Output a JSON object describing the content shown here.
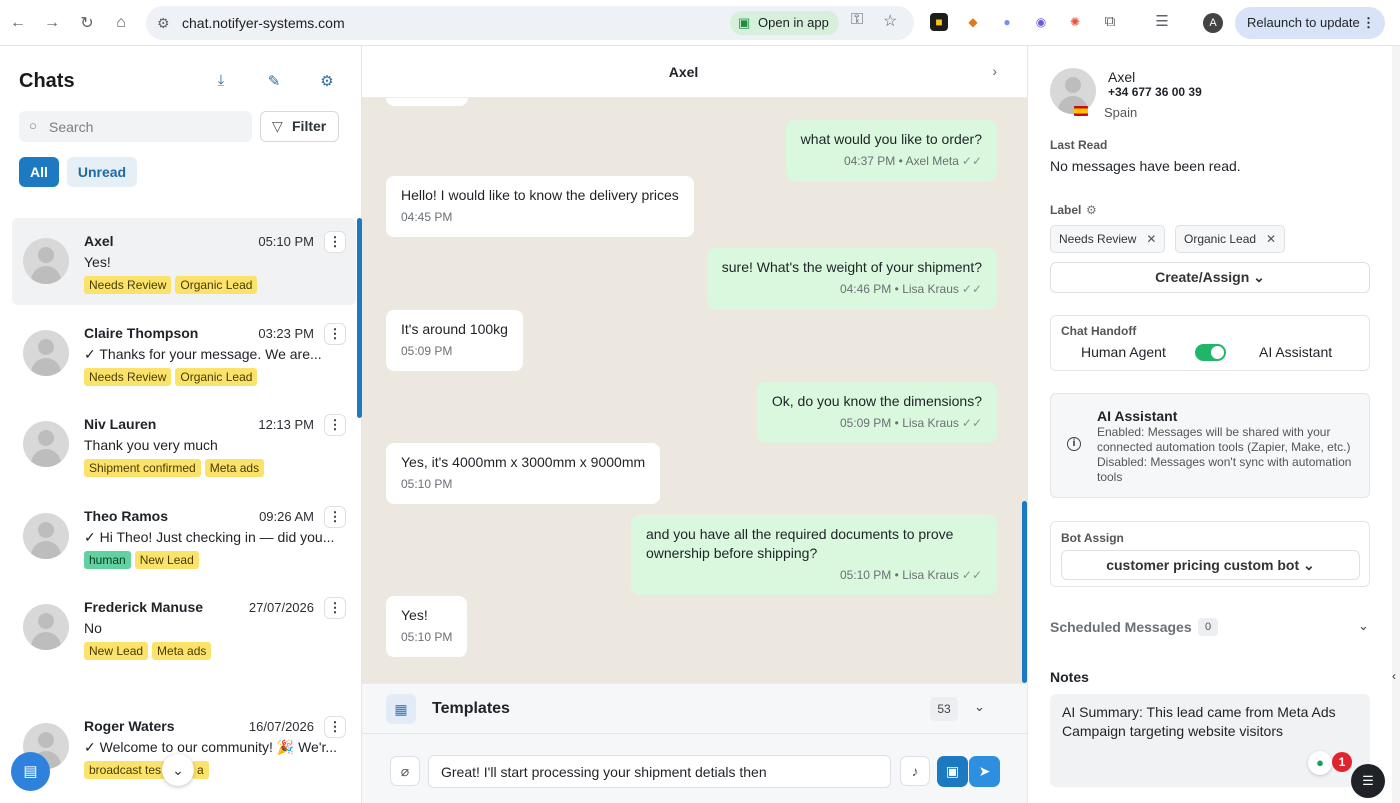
{
  "browser": {
    "url": "chat.notifyer-systems.com",
    "open_in_app": "Open in app",
    "profile_initial": "A",
    "relaunch": "Relaunch to update",
    "icons": [
      "back-icon",
      "forward-icon",
      "reload-icon",
      "home-icon",
      "site-settings-icon",
      "password-key-icon",
      "bookmark-star-icon",
      "extensions-icon",
      "reading-list-icon",
      "menu-dots-icon"
    ]
  },
  "sidebar": {
    "title": "Chats",
    "search_placeholder": "Search",
    "filter_label": "Filter",
    "segments": {
      "all": "All",
      "unread": "Unread"
    },
    "chats": [
      {
        "name": "Axel",
        "time": "05:10 PM",
        "message": "Yes!",
        "tags": [
          "Needs Review",
          "Organic Lead"
        ],
        "active": true
      },
      {
        "name": "Claire Thompson",
        "time": "03:23 PM",
        "message": "✓ Thanks for your message. We are...",
        "tags": [
          "Needs Review",
          "Organic Lead"
        ]
      },
      {
        "name": "Niv Lauren",
        "time": "12:13 PM",
        "message": "Thank you very much",
        "tags": [
          "Shipment confirmed",
          "Meta ads"
        ]
      },
      {
        "name": "Theo Ramos",
        "time": "09:26 AM",
        "message": "✓ Hi Theo! Just checking in — did you...",
        "tags": [
          "human",
          "New Lead"
        ]
      },
      {
        "name": "Frederick Manuse",
        "time": "27/07/2026",
        "message": "No",
        "tags": [
          "New Lead",
          "Meta ads"
        ]
      },
      {
        "name": "Roger Waters",
        "time": "16/07/2026",
        "message": "✓ Welcome to our community! 🎉 We'r...",
        "tags": [
          "broadcast tes",
          "a"
        ]
      }
    ]
  },
  "conversation": {
    "contact_name": "Axel",
    "messages": [
      {
        "dir": "out",
        "text": "what would you like to order?",
        "time": "04:37 PM",
        "sender": "Axel Meta"
      },
      {
        "dir": "in",
        "text": "Hello! I would like to know the delivery prices",
        "time": "04:45 PM"
      },
      {
        "dir": "out",
        "text": "sure! What's the weight of your shipment?",
        "time": "04:46 PM",
        "sender": "Lisa Kraus"
      },
      {
        "dir": "in",
        "text": "It's around 100kg",
        "time": "05:09 PM"
      },
      {
        "dir": "out",
        "text": "Ok, do you know the dimensions?",
        "time": "05:09 PM",
        "sender": "Lisa Kraus"
      },
      {
        "dir": "in",
        "text": "Yes, it's 4000mm x 3000mm x 9000mm",
        "time": "05:10 PM"
      },
      {
        "dir": "out",
        "text": "and you have all the required documents to prove ownership before shipping?",
        "time": "05:10 PM",
        "sender": "Lisa Kraus"
      },
      {
        "dir": "in",
        "text": "Yes!",
        "time": "05:10 PM"
      }
    ],
    "templates_label": "Templates",
    "templates_count": "53",
    "composer_value": "Great! I'll start processing your shipment detials then"
  },
  "contact": {
    "name": "Axel",
    "phone": "+34 677 36 00 39",
    "country": "Spain",
    "last_read_label": "Last Read",
    "last_read_value": "No messages have been read.",
    "label_title": "Label",
    "labels": [
      "Needs Review",
      "Organic Lead"
    ],
    "create_assign": "Create/Assign",
    "handoff_title": "Chat Handoff",
    "human_agent": "Human Agent",
    "ai_assistant": "AI Assistant",
    "handoff_ai_enabled": true,
    "ai_card_title": "AI Assistant",
    "ai_card_enabled": "Enabled: Messages will be shared with your connected automation tools (Zapier, Make, etc.)",
    "ai_card_disabled": "Disabled: Messages won't sync with automation tools",
    "bot_assign_title": "Bot Assign",
    "bot_selected": "customer pricing custom bot",
    "scheduled_label": "Scheduled Messages",
    "scheduled_count": "0",
    "notes_title": "Notes",
    "notes_text": "AI Summary: This lead came from Meta Ads Campaign targeting website visitors",
    "grammar_badge": "1"
  },
  "colors": {
    "accent": "#1d7ac0",
    "outgoing_bubble": "#d9f8dd",
    "chat_bg": "#ece7df",
    "tag_yellow": "#fbe36b",
    "tag_green": "#62d1a0",
    "toggle_on": "#21b56a"
  }
}
